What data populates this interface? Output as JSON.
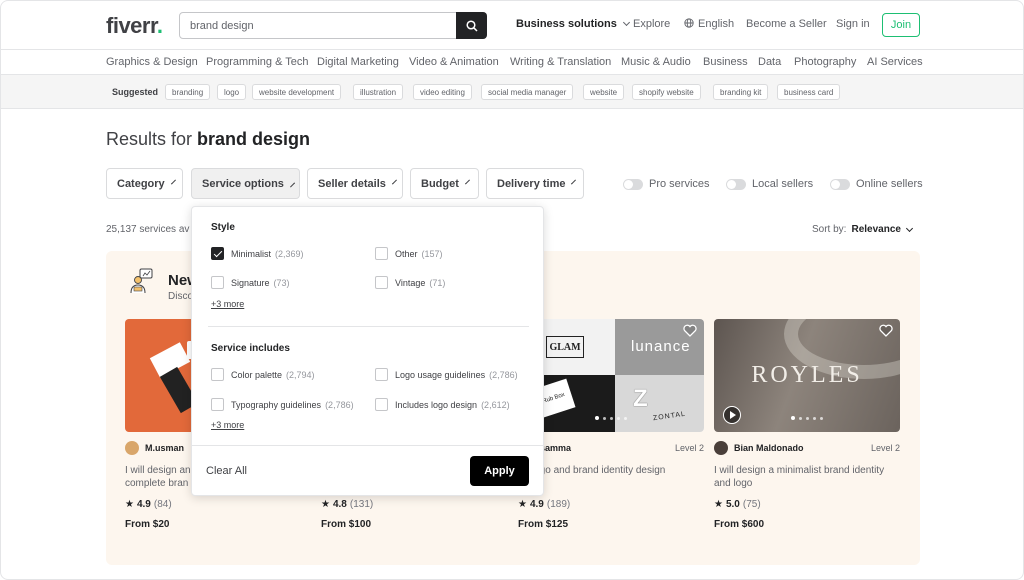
{
  "header": {
    "logo": "fiverr",
    "logo_dot": ".",
    "search_value": "brand design",
    "nav": {
      "business_solutions": "Business solutions",
      "explore": "Explore",
      "language": "English",
      "become_seller": "Become a Seller",
      "sign_in": "Sign in",
      "join": "Join"
    }
  },
  "categories": [
    "Graphics & Design",
    "Programming & Tech",
    "Digital Marketing",
    "Video & Animation",
    "Writing & Translation",
    "Music & Audio",
    "Business",
    "Data",
    "Photography",
    "AI Services"
  ],
  "suggested": {
    "label": "Suggested",
    "chips": [
      "branding",
      "logo",
      "website development",
      "illustration",
      "video editing",
      "social media manager",
      "website",
      "shopify website",
      "branding kit",
      "business card"
    ]
  },
  "results": {
    "prefix": "Results for ",
    "query": "brand design",
    "count": "25,137 services av",
    "sort_label": "Sort by:",
    "sort_value": "Relevance"
  },
  "filters": {
    "category": "Category",
    "service_options": "Service options",
    "seller_details": "Seller details",
    "budget": "Budget",
    "delivery_time": "Delivery time",
    "toggles": [
      "Pro services",
      "Local sellers",
      "Online sellers"
    ]
  },
  "dropdown": {
    "style_title": "Style",
    "style_options": [
      {
        "label": "Minimalist",
        "count": "(2,369)",
        "checked": true
      },
      {
        "label": "Other",
        "count": "(157)",
        "checked": false
      },
      {
        "label": "Signature",
        "count": "(73)",
        "checked": false
      },
      {
        "label": "Vintage",
        "count": "(71)",
        "checked": false
      }
    ],
    "style_more": "+3 more",
    "includes_title": "Service includes",
    "includes_options": [
      {
        "label": "Color palette",
        "count": "(2,794)",
        "checked": false
      },
      {
        "label": "Logo usage guidelines",
        "count": "(2,786)",
        "checked": false
      },
      {
        "label": "Typography guidelines",
        "count": "(2,786)",
        "checked": false
      },
      {
        "label": "Includes logo design",
        "count": "(2,612)",
        "checked": false
      }
    ],
    "includes_more": "+3 more",
    "clear_all": "Clear All",
    "apply": "Apply"
  },
  "featured": {
    "title": "New",
    "subtitle": "Disco"
  },
  "cards": [
    {
      "seller": "M.usman",
      "level": "",
      "title": "I will design an ... complete bran",
      "title_line1": "I will design an",
      "title_line2": "complete bran",
      "rating": "4.9",
      "reviews": "(84)",
      "price": "From $20",
      "image_text": ""
    },
    {
      "seller": "",
      "level": "",
      "title_line1": "",
      "title_line2": "",
      "rating": "4.8",
      "reviews": "(131)",
      "price": "From $100",
      "image_text": ""
    },
    {
      "seller": "K Valsamma",
      "level": "Level 2",
      "title_line1": "do logo and brand identity design",
      "title_line2": "",
      "rating": "4.9",
      "reviews": "(189)",
      "price": "From $125",
      "image_text": "GLAM",
      "image_text2": "lunance",
      "image_text3": "the Rub Box",
      "image_text4": "ZONTAL"
    },
    {
      "seller": "Bian Maldonado",
      "level": "Level 2",
      "title_line1": "I will design a minimalist brand identity",
      "title_line2": "and logo",
      "rating": "5.0",
      "reviews": "(75)",
      "price": "From $600",
      "image_text": "ROYLES"
    }
  ],
  "colors": {
    "brand_green": "#1dbf73",
    "text_dark": "#222325",
    "featured_bg": "#fdf6ee",
    "apply_bg": "#000000"
  }
}
